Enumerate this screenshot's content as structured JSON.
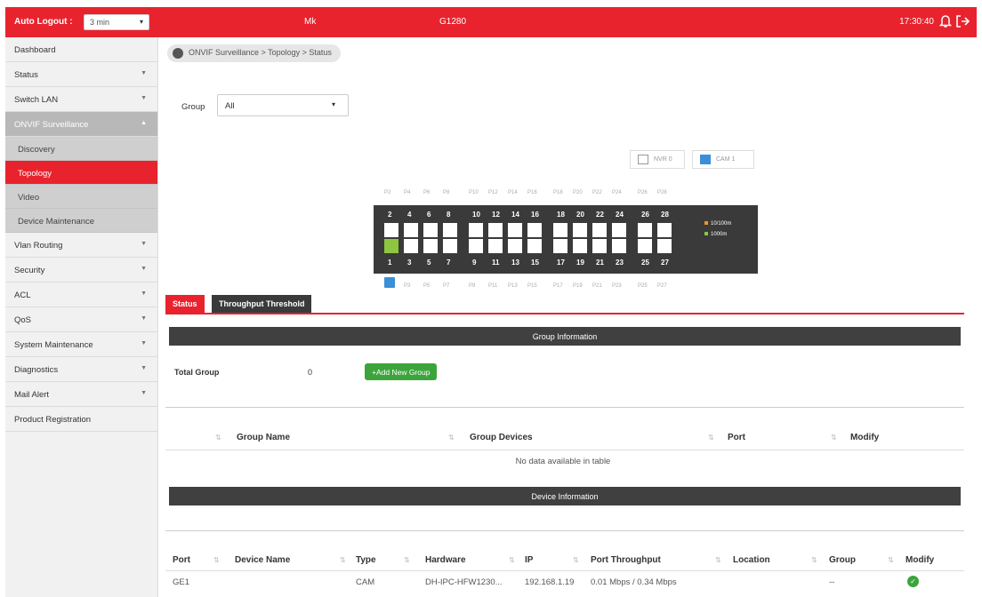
{
  "topbar": {
    "auto_logout_label": "Auto Logout :",
    "auto_logout_value": "3 min",
    "host": "Mk",
    "model": "G1280",
    "time": "17:30:40"
  },
  "sidebar": {
    "items": [
      {
        "label": "Dashboard"
      },
      {
        "label": "Status"
      },
      {
        "label": "Switch LAN"
      },
      {
        "label": "ONVIF Surveillance"
      },
      {
        "label": "Discovery"
      },
      {
        "label": "Topology"
      },
      {
        "label": "Video"
      },
      {
        "label": "Device Maintenance"
      },
      {
        "label": "Vlan Routing"
      },
      {
        "label": "Security"
      },
      {
        "label": "ACL"
      },
      {
        "label": "QoS"
      },
      {
        "label": "System Maintenance"
      },
      {
        "label": "Diagnostics"
      },
      {
        "label": "Mail Alert"
      },
      {
        "label": "Product Registration"
      }
    ]
  },
  "breadcrumb": "ONVIF Surveillance > Topology > Status",
  "group_filter": {
    "label": "Group",
    "value": "All"
  },
  "legend": {
    "nvr": "NVR 0",
    "cam": "CAM 1"
  },
  "switch": {
    "top_numbers": [
      "2",
      "4",
      "6",
      "8",
      "10",
      "12",
      "14",
      "16",
      "18",
      "20",
      "22",
      "24",
      "26",
      "28"
    ],
    "bottom_numbers": [
      "1",
      "3",
      "5",
      "7",
      "9",
      "11",
      "13",
      "15",
      "17",
      "19",
      "21",
      "23",
      "25",
      "27"
    ],
    "top_port_labels": [
      "P2",
      "P4",
      "P6",
      "P8",
      "P10",
      "P12",
      "P14",
      "P16",
      "P18",
      "P20",
      "P22",
      "P24",
      "P26",
      "P28"
    ],
    "bottom_port_labels": [
      "P3",
      "P5",
      "P7",
      "P9",
      "P11",
      "P13",
      "P15",
      "P17",
      "P19",
      "P21",
      "P23",
      "P25",
      "P27"
    ],
    "speed_legend": [
      "10/100m",
      "1000m"
    ],
    "colors": {
      "speed_100": "#f7941d",
      "speed_1000": "#8dc63f"
    }
  },
  "tabs": {
    "status": "Status",
    "threshold": "Throughput Threshold"
  },
  "group_info": {
    "title": "Group Information",
    "total_label": "Total Group",
    "total_value": "0",
    "add_button": "+Add New Group",
    "columns": [
      "Group Name",
      "Group Devices",
      "Port",
      "Modify"
    ],
    "empty": "No data available in table"
  },
  "device_info": {
    "title": "Device Information",
    "columns": [
      "Port",
      "Device Name",
      "Type",
      "Hardware",
      "IP",
      "Port Throughput",
      "Location",
      "Group",
      "Modify"
    ],
    "rows": [
      {
        "port": "GE1",
        "device_name": "",
        "type": "CAM",
        "hardware": "DH-IPC-HFW1230...",
        "ip": "192.168.1.19",
        "throughput": "0.01 Mbps / 0.34 Mbps",
        "location": "",
        "group": "--"
      }
    ]
  },
  "accent_color": "#e8232e"
}
